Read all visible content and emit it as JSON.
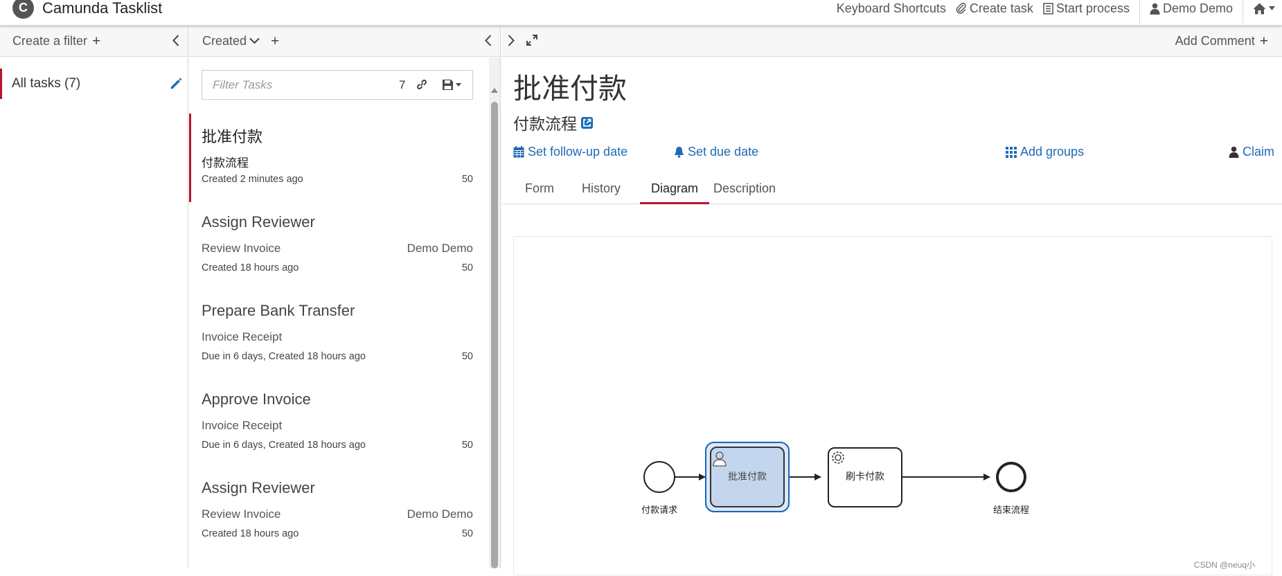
{
  "app": {
    "title": "Camunda Tasklist",
    "logo_letter": "C"
  },
  "topnav": {
    "keyboard_shortcuts": "Keyboard Shortcuts",
    "create_task": "Create task",
    "start_process": "Start process",
    "user": "Demo Demo"
  },
  "filters": {
    "create_label": "Create a filter",
    "items": [
      {
        "label": "All tasks (7)"
      }
    ]
  },
  "list": {
    "sort_label": "Created",
    "filter_placeholder": "Filter Tasks",
    "filter_count": "7",
    "tasks": [
      {
        "name": "批准付款",
        "process": "付款流程",
        "assignee": "",
        "meta": "Created 2 minutes ago",
        "priority": "50"
      },
      {
        "name": "Assign Reviewer",
        "process": "Review Invoice",
        "assignee": "Demo Demo",
        "meta": "Created 18 hours ago",
        "priority": "50"
      },
      {
        "name": "Prepare Bank Transfer",
        "process": "Invoice Receipt",
        "assignee": "",
        "meta": "Due in 6 days, Created 18 hours ago",
        "priority": "50"
      },
      {
        "name": "Approve Invoice",
        "process": "Invoice Receipt",
        "assignee": "",
        "meta": "Due in 6 days, Created 18 hours ago",
        "priority": "50"
      },
      {
        "name": "Assign Reviewer",
        "process": "Review Invoice",
        "assignee": "Demo Demo",
        "meta": "Created 18 hours ago",
        "priority": "50"
      }
    ]
  },
  "detail": {
    "add_comment": "Add Comment",
    "title": "批准付款",
    "process": "付款流程",
    "actions": {
      "follow_up": "Set follow-up date",
      "due": "Set due date",
      "groups": "Add groups",
      "claim": "Claim"
    },
    "tabs": [
      "Form",
      "History",
      "Diagram",
      "Description"
    ],
    "active_tab": "Diagram",
    "diagram": {
      "start_event": "付款请求",
      "user_task": "批准付款",
      "service_task": "刷卡付款",
      "end_event": "结束流程"
    }
  },
  "watermark": "CSDN @neuq小",
  "colors": {
    "accent": "#b5152b",
    "link": "#1d6bb5",
    "task_highlight": "#c4d6ee",
    "task_border": "#1565c0"
  },
  "icons": [
    "user-icon",
    "home-icon",
    "paperclip-icon",
    "list-icon",
    "pencil-icon",
    "link-icon",
    "save-icon",
    "calendar-icon",
    "bell-icon",
    "grid-icon",
    "external-link-icon",
    "expand-icon",
    "user-task-icon",
    "gear-icon"
  ]
}
